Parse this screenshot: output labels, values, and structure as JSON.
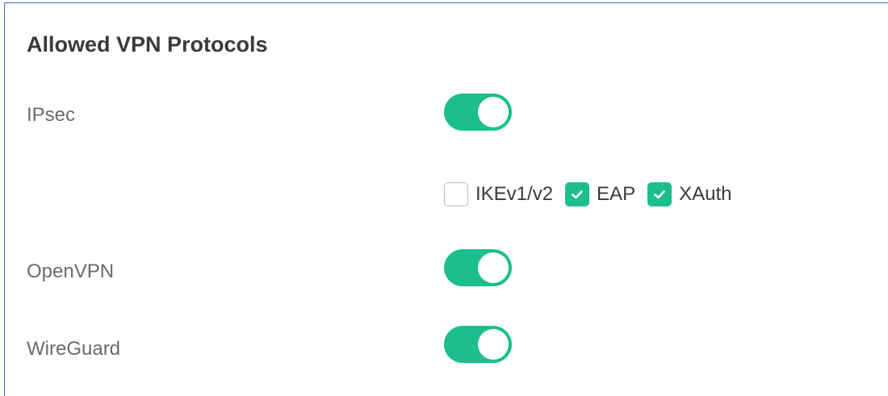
{
  "section": {
    "title": "Allowed VPN Protocols"
  },
  "rows": {
    "ipsec": {
      "label": "IPsec",
      "enabled": true
    },
    "openvpn": {
      "label": "OpenVPN",
      "enabled": true
    },
    "wireguard": {
      "label": "WireGuard",
      "enabled": true
    }
  },
  "ipsec_options": {
    "ikev": {
      "label": "IKEv1/v2",
      "checked": false
    },
    "eap": {
      "label": "EAP",
      "checked": true
    },
    "xauth": {
      "label": "XAuth",
      "checked": true
    }
  },
  "colors": {
    "accent": "#1cbf8b",
    "border": "#3d6fb5",
    "label_text": "#6b6b6b",
    "title_text": "#3a3a3a"
  }
}
